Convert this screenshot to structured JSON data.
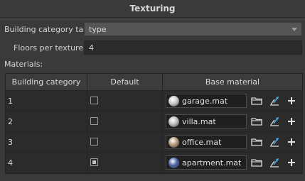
{
  "section": {
    "title": "Texturing"
  },
  "form": {
    "building_category_tag": {
      "label": "Building category tag:",
      "value": "type"
    },
    "floors_per_texture": {
      "label": "Floors per texture:",
      "value": "4"
    },
    "materials_label": "Materials:"
  },
  "table": {
    "headers": [
      "Building category",
      "Default",
      "Base material"
    ],
    "rows": [
      {
        "category": "1",
        "default": false,
        "material": "garage.mat",
        "ball_color": "#c9c9c9"
      },
      {
        "category": "2",
        "default": false,
        "material": "villa.mat",
        "ball_color": "#bdbdbd"
      },
      {
        "category": "3",
        "default": false,
        "material": "office.mat",
        "ball_color": "#b39a7a"
      },
      {
        "category": "4",
        "default": true,
        "material": "apartment.mat",
        "ball_color": "#4a66a8"
      }
    ]
  },
  "icons": {
    "browse": "folder-icon",
    "edit": "edit-arrow-icon",
    "add": "plus-icon"
  },
  "colors": {
    "background": "#3a3a3a",
    "table_bg": "#2b2b2b",
    "accent_arrow": "#4aa6e8"
  }
}
